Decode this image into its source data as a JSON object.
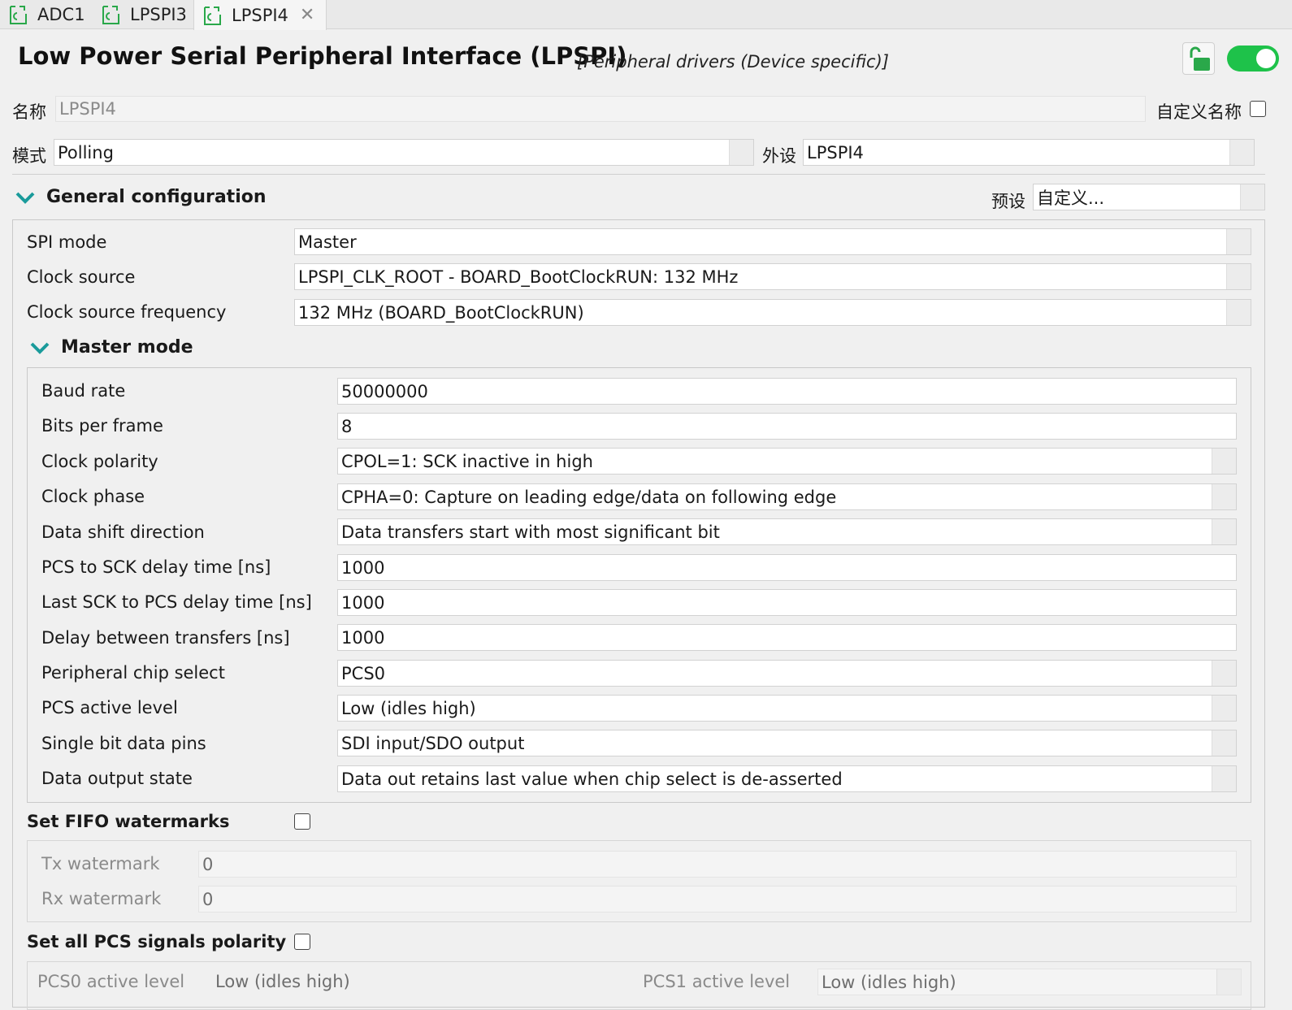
{
  "tabs": [
    {
      "label": "ADC1"
    },
    {
      "label": "LPSPI3"
    },
    {
      "label": "LPSPI4"
    }
  ],
  "header": {
    "title": "Low Power Serial Peripheral Interface (LPSPI)",
    "subtitle": "[Peripheral drivers (Device specific)]",
    "enabled": true,
    "colors": {
      "toggle": "#1ec24a",
      "icon": "#2aa84a"
    }
  },
  "name_row": {
    "label": "名称",
    "value": "LPSPI4",
    "custom_label": "自定义名称"
  },
  "mode_row": {
    "mode_label": "模式",
    "mode_value": "Polling",
    "peripheral_label": "外设",
    "peripheral_value": "LPSPI4"
  },
  "general": {
    "title": "General configuration",
    "preset_label": "预设",
    "preset_value": "自定义...",
    "rows": [
      {
        "label": "SPI mode",
        "value": "Master"
      },
      {
        "label": "Clock source",
        "value": "LPSPI_CLK_ROOT - BOARD_BootClockRUN: 132 MHz"
      },
      {
        "label": "Clock source frequency",
        "value": "132 MHz (BOARD_BootClockRUN)"
      }
    ]
  },
  "master": {
    "title": "Master mode",
    "rows": [
      {
        "label": "Baud rate",
        "value": "50000000"
      },
      {
        "label": "Bits per frame",
        "value": "8"
      },
      {
        "label": "Clock polarity",
        "value": "CPOL=1: SCK inactive in high"
      },
      {
        "label": "Clock phase",
        "value": "CPHA=0: Capture on leading edge/data on following edge"
      },
      {
        "label": "Data shift direction",
        "value": "Data transfers start with most significant bit"
      },
      {
        "label": "PCS to SCK delay time [ns]",
        "value": "1000"
      },
      {
        "label": "Last SCK to PCS delay time [ns]",
        "value": "1000"
      },
      {
        "label": "Delay between transfers [ns]",
        "value": "1000"
      },
      {
        "label": "Peripheral chip select",
        "value": "PCS0"
      },
      {
        "label": "PCS active level",
        "value": "Low (idles high)"
      },
      {
        "label": "Single bit data pins",
        "value": "SDI input/SDO output"
      },
      {
        "label": "Data output state",
        "value": "Data out retains last value when chip select is de-asserted"
      }
    ]
  },
  "fifo": {
    "title": "Set FIFO watermarks",
    "checked": false,
    "rows": [
      {
        "label": "Tx watermark",
        "value": "0"
      },
      {
        "label": "Rx watermark",
        "value": "0"
      }
    ]
  },
  "pcs_polarity": {
    "title": "Set all PCS signals polarity",
    "checked": false,
    "pcs0_label": "PCS0 active level",
    "pcs0_value": "Low (idles high)",
    "pcs1_label": "PCS1 active level",
    "pcs1_value": "Low (idles high)"
  }
}
